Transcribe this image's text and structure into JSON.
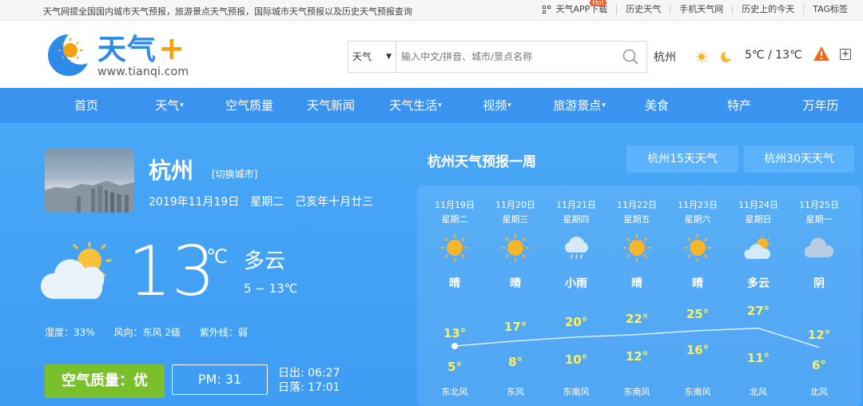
{
  "topbar": {
    "notice": "天气网提全国国内城市天气预报，旅游景点天气预报，国际城市天气预报以及历史天气预报查询",
    "links": [
      "天气APP下载",
      "历史天气",
      "手机天气网",
      "历史上的今天",
      "TAG标签"
    ],
    "badge": "Hot"
  },
  "header": {
    "brand": "天气",
    "brand_plus": "+",
    "url": "www.tianqi.com",
    "search_select": "天气",
    "search_placeholder": "输入中文/拼音、城市/景点名称",
    "city": "杭州",
    "temp": "5℃ / 13℃"
  },
  "nav": [
    "首页",
    "天气",
    "空气质量",
    "天气新闻",
    "天气生活",
    "视频",
    "旅游景点",
    "美食",
    "特产",
    "万年历"
  ],
  "nav_dropdown": [
    false,
    true,
    false,
    false,
    true,
    true,
    true,
    false,
    false,
    false
  ],
  "current": {
    "city": "杭州",
    "switch": "[切换城市]",
    "date": "2019年11月19日　星期二　己亥年十月廿三",
    "temp": "13",
    "unit": "℃",
    "condition": "多云",
    "range": "5 ~ 13℃",
    "humidity": "湿度：33%",
    "wind": "风向：东风 2级",
    "uv": "紫外线：弱",
    "aqi": "空气质量：优",
    "pm": "PM: 31",
    "sunrise": "日出: 06:27",
    "sunset": "日落: 17:01"
  },
  "forecast": {
    "title": "杭州天气预报一周",
    "btn15": "杭州15天天气",
    "btn30": "杭州30天天气",
    "days": [
      {
        "date": "11月19日",
        "week": "星期二",
        "icon": "sun-icon",
        "cond": "晴",
        "high": 13,
        "low": 5,
        "wind": "东北风"
      },
      {
        "date": "11月20日",
        "week": "星期三",
        "icon": "sun-icon",
        "cond": "晴",
        "high": 17,
        "low": 8,
        "wind": "东风"
      },
      {
        "date": "11月21日",
        "week": "星期四",
        "icon": "light-rain-icon",
        "cond": "小雨",
        "high": 20,
        "low": 10,
        "wind": "东南风"
      },
      {
        "date": "11月22日",
        "week": "星期五",
        "icon": "sun-icon",
        "cond": "晴",
        "high": 22,
        "low": 12,
        "wind": "东南风"
      },
      {
        "date": "11月23日",
        "week": "星期六",
        "icon": "sun-icon",
        "cond": "晴",
        "high": 25,
        "low": 16,
        "wind": "东南风"
      },
      {
        "date": "11月24日",
        "week": "星期日",
        "icon": "partly-cloudy-icon",
        "cond": "多云",
        "high": 27,
        "low": 11,
        "wind": "北风"
      },
      {
        "date": "11月25日",
        "week": "星期一",
        "icon": "overcast-icon",
        "cond": "阴",
        "high": 12,
        "low": 6,
        "wind": "北风"
      }
    ]
  },
  "colors": {
    "nav": "#3a93ef",
    "main": "#45a3f5",
    "aqi": "#7ac02c",
    "temp_label": "#ffef5a",
    "brand": "#2c8ae8"
  }
}
